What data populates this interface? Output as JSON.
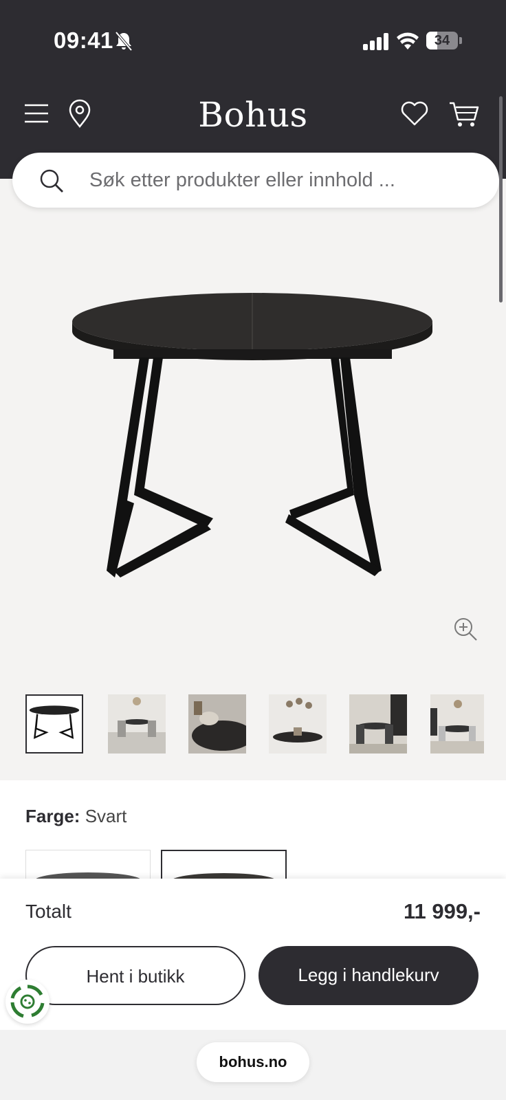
{
  "status_bar": {
    "time": "09:41",
    "battery": "34",
    "battery_level": 0.34
  },
  "header": {
    "logo": "Bohus"
  },
  "search": {
    "placeholder": "Søk etter produkter eller innhold ..."
  },
  "product": {
    "color_label": "Farge:",
    "color_value": "Svart"
  },
  "footer": {
    "total_label": "Totalt",
    "total_price": "11 999,-",
    "store_button": "Hent i butikk",
    "cart_button": "Legg i handlekurv",
    "url": "bohus.no"
  },
  "icons": [
    "menu-icon",
    "location-pin-icon",
    "heart-icon",
    "cart-icon",
    "search-icon",
    "zoom-in-icon",
    "bell-off-icon",
    "signal-icon",
    "wifi-icon",
    "cookie-settings-icon"
  ],
  "colors": {
    "header_bg": "#2d2c31",
    "image_bg": "#f4f3f2",
    "primary_button": "#2d2c31"
  }
}
